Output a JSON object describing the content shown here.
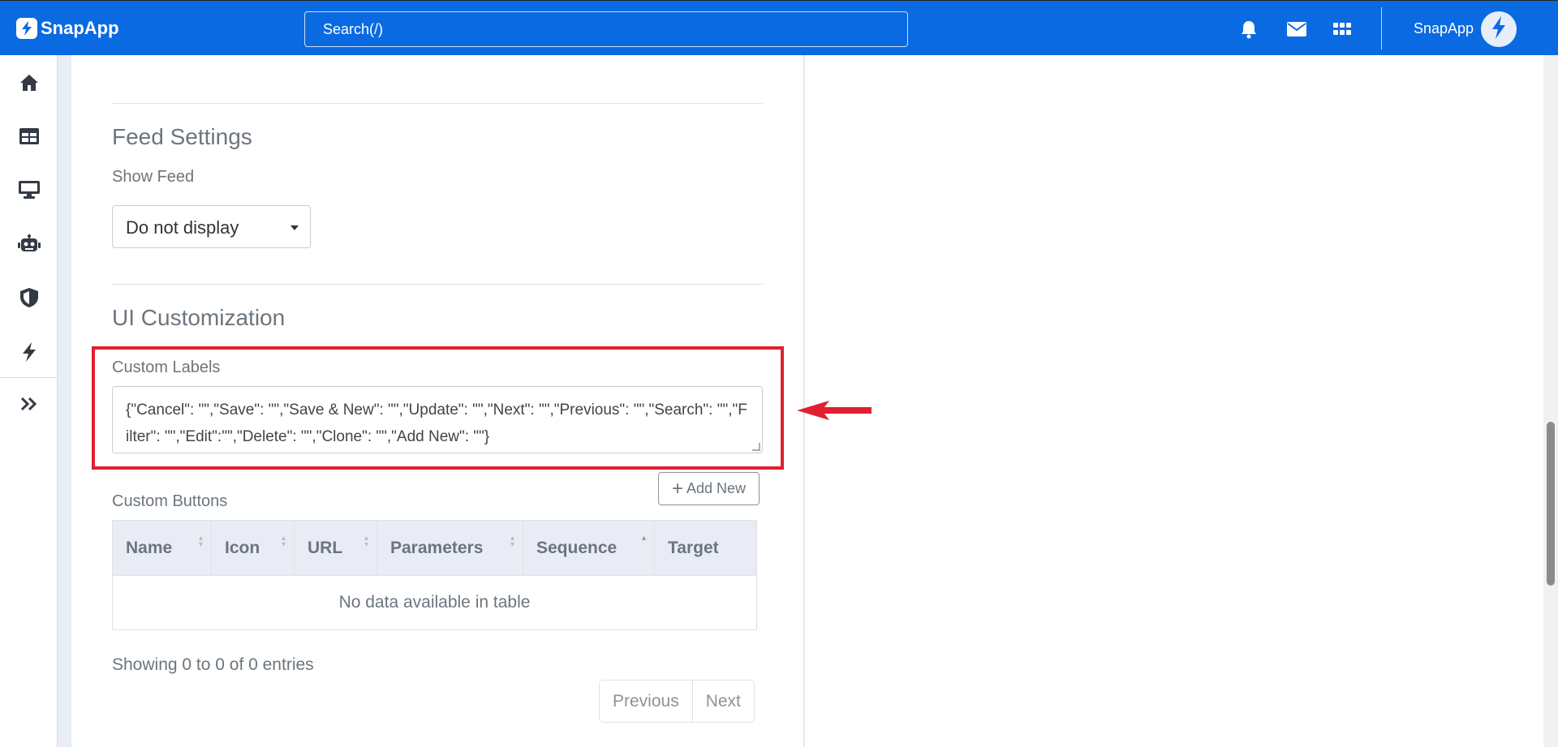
{
  "app": {
    "brand": "SnapApp",
    "search_placeholder": "Search(/)",
    "user_name": "SnapApp",
    "colors": {
      "header": "#0a6ae2",
      "highlight": "#e02030"
    }
  },
  "header_icons": [
    "bell-icon",
    "mail-icon",
    "apps-grid-icon",
    "bolt-icon"
  ],
  "sidebar": {
    "items": [
      "home-icon",
      "table-icon",
      "monitor-icon",
      "robot-icon",
      "shield-icon",
      "bolt-icon",
      "expand-chevrons-icon"
    ]
  },
  "feed": {
    "title": "Feed Settings",
    "show_feed_label": "Show Feed",
    "show_feed_value": "Do not display"
  },
  "ui_custom": {
    "title": "UI Customization",
    "custom_labels_label": "Custom Labels",
    "custom_labels_value": "{\"Cancel\": \"\",\"Save\": \"\",\"Save & New\": \"\",\"Update\": \"\",\"Next\": \"\",\"Previous\": \"\",\"Search\": \"\",\"Filter\": \"\",\"Edit\":\"\",\"Delete\": \"\",\"Clone\": \"\",\"Add New\": \"\"}",
    "custom_buttons_label": "Custom Buttons",
    "add_new_label": "Add New"
  },
  "table": {
    "columns": [
      "Name",
      "Icon",
      "URL",
      "Parameters",
      "Sequence",
      "Target"
    ],
    "empty_text": "No data available in table",
    "showing_text": "Showing 0 to 0 of 0 entries",
    "previous_label": "Previous",
    "next_label": "Next"
  }
}
